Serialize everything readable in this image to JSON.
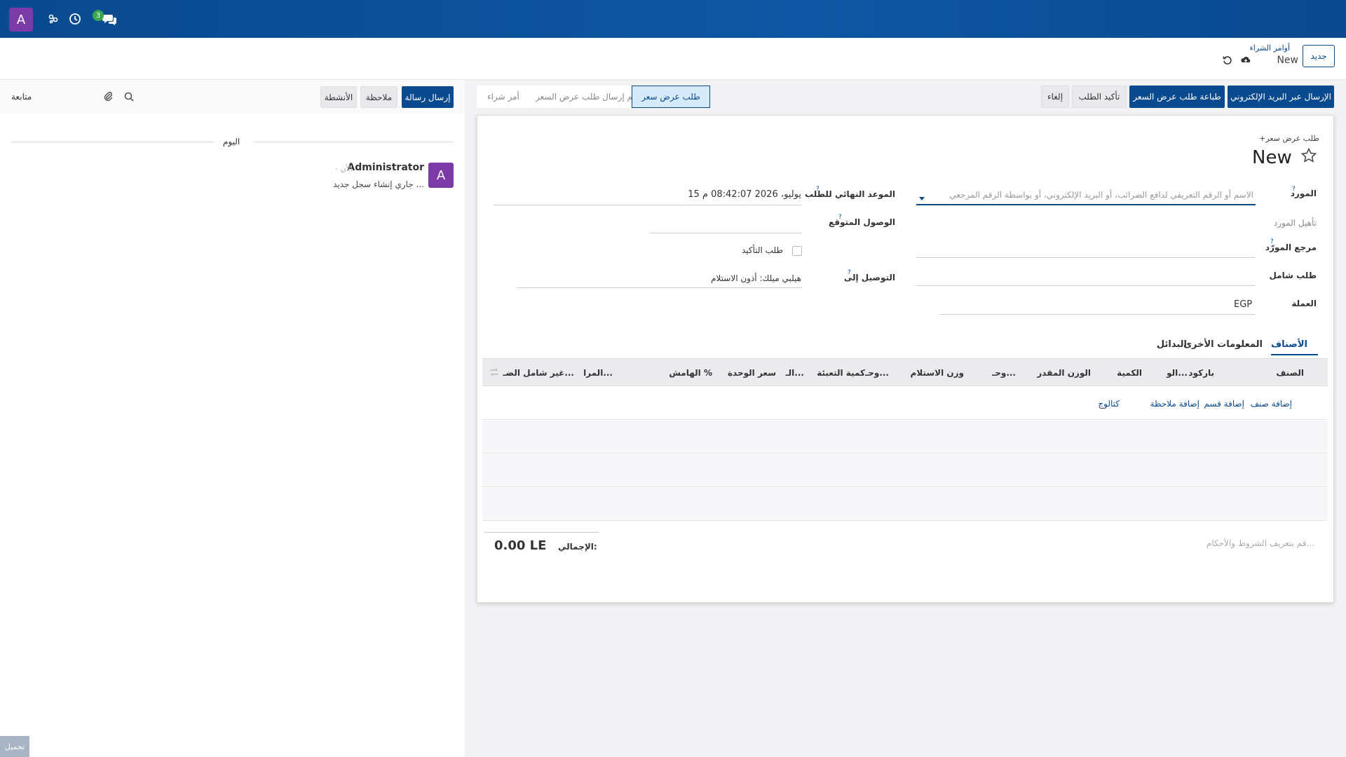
{
  "navbar": {
    "avatar_letter": "A",
    "messages_badge": "3"
  },
  "control_panel": {
    "new_button": "جديد",
    "breadcrumb_parent": "أوامر الشراء",
    "breadcrumb_current": "New"
  },
  "statusbar": {
    "send_email": "الإرسال عبر البريد الإلكتروني",
    "print_rfq": "طباعة طلب عرض السعر",
    "confirm_order": "تأكيد الطلب",
    "cancel": "إلغاء",
    "stages": [
      "أمر شراء",
      "تم إرسال طلب عرض السعر",
      "طلب عرض سعر"
    ],
    "active_stage": "طلب عرض سعر"
  },
  "form": {
    "subtitle": "+طلب عرض سعر",
    "title": "New",
    "vendor_label": "المورد",
    "vendor_placeholder": "الاسم أو الرقم التعريفي لدافع الضرائب، أو البريد الإلكتروني، أو بواسطة الرقم المرجعي",
    "vendor_qualification_label": "تأهيل المورد",
    "vendor_reference_label": "مرجع المورّد",
    "blanket_order_label": "طلب شامل",
    "currency_label": "العملة",
    "currency_value": "EGP",
    "order_deadline_label": "الموعد النهائي للطلب",
    "order_deadline_value": "15 يوليو، 2026 08:42:07 م",
    "expected_arrival_label": "الوصول المتوقع",
    "ask_confirmation_label": "طلب التأكيد",
    "deliver_to_label": "التوصيل إلى",
    "deliver_to_value": "هيلبي ميلك: أذون الاستلام"
  },
  "tabs": [
    "الأصناف",
    "المعلومات الأخرى",
    "البدائل"
  ],
  "table": {
    "headers": [
      "الصنف",
      "باركود",
      "الو...",
      "الكمية",
      "الوزن المقدر",
      "وحـ...",
      "وزن الاستلام",
      "وحـ...",
      "كمية التعبئة",
      "الـ...",
      "سعر الوحدة",
      "الهامش %",
      "المرا...",
      "غير شامل الضـ..."
    ],
    "add_product": "إضافة صنف",
    "add_section": "إضافة قسم",
    "add_note": "إضافة ملاحظة",
    "catalog": "كتالوج"
  },
  "totals": {
    "label": "الإجمالي:",
    "value": "0.00 LE",
    "terms_placeholder": "قم بتعريف الشروط والأحكام..."
  },
  "chatter": {
    "send_message": "إرسال رسالة",
    "log_note": "ملاحظة",
    "activities": "الأنشطة",
    "follow": "متابعة",
    "today": "اليوم",
    "author": "Administrator",
    "time": "- الآن",
    "message": "جاري إنشاء سجل جديد ...",
    "avatar_letter": "A"
  },
  "upload_button": "تحميل",
  "colors": {
    "brand": "#0a4a8f",
    "avatar": "#7c3aa8",
    "badge": "#3aa64d"
  }
}
